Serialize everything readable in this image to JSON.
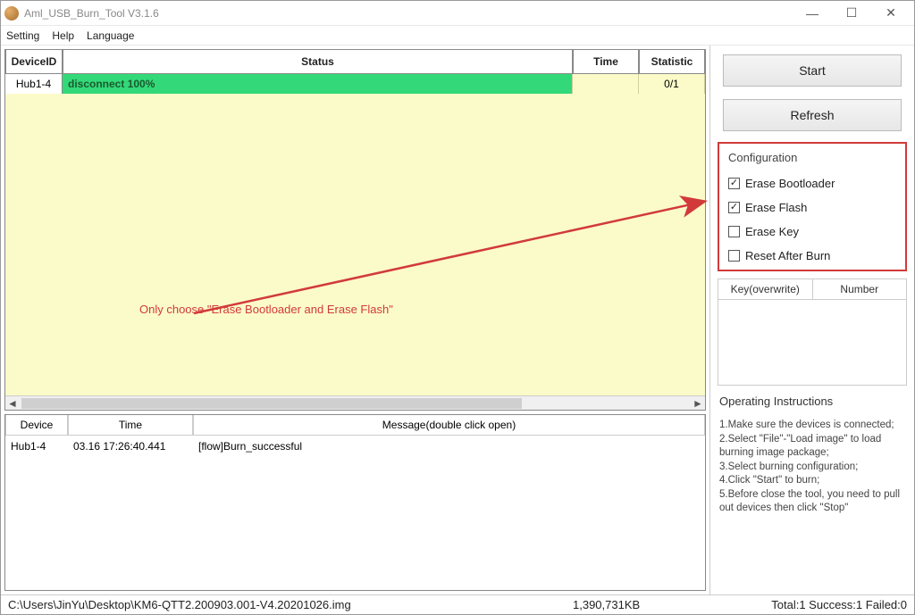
{
  "window": {
    "title": "Aml_USB_Burn_Tool V3.1.6"
  },
  "menu": {
    "setting": "Setting",
    "help": "Help",
    "language": "Language"
  },
  "table": {
    "headers": {
      "id": "DeviceID",
      "status": "Status",
      "time": "Time",
      "stat": "Statistic"
    },
    "row": {
      "id": "Hub1-4",
      "status": "disconnect 100%",
      "time": "",
      "stat": "0/1"
    }
  },
  "annotation": "Only choose \"Erase Bootloader and Erase Flash\"",
  "log": {
    "headers": {
      "device": "Device",
      "time": "Time",
      "message": "Message(double click open)"
    },
    "row": {
      "device": "Hub1-4",
      "time": "03.16 17:26:40.441",
      "message": "[flow]Burn_successful"
    }
  },
  "buttons": {
    "start": "Start",
    "refresh": "Refresh"
  },
  "config": {
    "title": "Configuration",
    "erase_bootloader": "Erase Bootloader",
    "erase_flash": "Erase Flash",
    "erase_key": "Erase Key",
    "reset_after_burn": "Reset After Burn"
  },
  "keynum": {
    "key": "Key(overwrite)",
    "number": "Number"
  },
  "instructions": {
    "title": "Operating Instructions",
    "l1": "1.Make sure the devices is connected;",
    "l2": "2.Select \"File\"-\"Load image\" to load burning image package;",
    "l3": "3.Select burning configuration;",
    "l4": "4.Click \"Start\" to burn;",
    "l5": "5.Before close the tool, you need to pull out devices then click \"Stop\""
  },
  "status": {
    "path": "C:\\Users\\JinYu\\Desktop\\KM6-QTT2.200903.001-V4.20201026.img",
    "size": "1,390,731KB",
    "totals": "Total:1  Success:1  Failed:0"
  },
  "glyphs": {
    "check": "✓",
    "min": "—",
    "max": "☐",
    "close": "✕",
    "left": "◄",
    "right": "►"
  }
}
